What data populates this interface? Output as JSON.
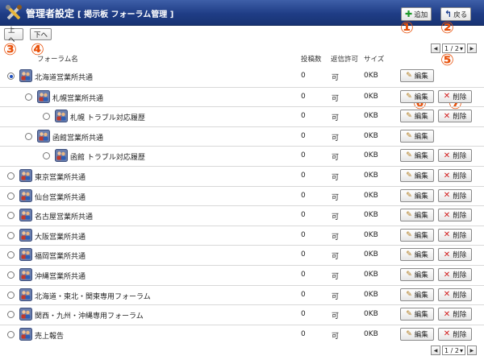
{
  "header": {
    "title": "管理者設定",
    "subtitle": "[ 掲示板 フォーラム管理 ]",
    "add_label": "追加",
    "back_label": "戻る"
  },
  "nav": {
    "up_label": "上へ",
    "down_label": "下へ"
  },
  "pager": {
    "value": "1 / 2"
  },
  "callouts": [
    "①",
    "②",
    "③",
    "④",
    "⑤",
    "⑥",
    "⑦"
  ],
  "columns": {
    "name": "フォーラム名",
    "posts": "投稿数",
    "reply": "返信許可",
    "size": "サイズ"
  },
  "buttons": {
    "edit": "編集",
    "delete": "削除"
  },
  "rows": [
    {
      "name": "北海道営業所共通",
      "posts": "0",
      "reply": "可",
      "size": "0KB",
      "level": 0,
      "selected": true,
      "deletable": false
    },
    {
      "name": "札幌営業所共通",
      "posts": "0",
      "reply": "可",
      "size": "0KB",
      "level": 1,
      "selected": false,
      "deletable": true
    },
    {
      "name": "札幌 トラブル対応履歴",
      "posts": "0",
      "reply": "可",
      "size": "0KB",
      "level": 2,
      "selected": false,
      "deletable": true
    },
    {
      "name": "函館営業所共通",
      "posts": "0",
      "reply": "可",
      "size": "0KB",
      "level": 1,
      "selected": false,
      "deletable": false
    },
    {
      "name": "函館 トラブル対応履歴",
      "posts": "0",
      "reply": "可",
      "size": "0KB",
      "level": 2,
      "selected": false,
      "deletable": true
    },
    {
      "name": "東京営業所共通",
      "posts": "0",
      "reply": "可",
      "size": "0KB",
      "level": 0,
      "selected": false,
      "deletable": true
    },
    {
      "name": "仙台営業所共通",
      "posts": "0",
      "reply": "可",
      "size": "0KB",
      "level": 0,
      "selected": false,
      "deletable": true
    },
    {
      "name": "名古屋営業所共通",
      "posts": "0",
      "reply": "可",
      "size": "0KB",
      "level": 0,
      "selected": false,
      "deletable": true
    },
    {
      "name": "大阪営業所共通",
      "posts": "0",
      "reply": "可",
      "size": "0KB",
      "level": 0,
      "selected": false,
      "deletable": true
    },
    {
      "name": "福岡営業所共通",
      "posts": "0",
      "reply": "可",
      "size": "0KB",
      "level": 0,
      "selected": false,
      "deletable": true
    },
    {
      "name": "沖縄営業所共通",
      "posts": "0",
      "reply": "可",
      "size": "0KB",
      "level": 0,
      "selected": false,
      "deletable": true
    },
    {
      "name": "北海道・東北・関東専用フォーラム",
      "posts": "0",
      "reply": "可",
      "size": "0KB",
      "level": 0,
      "selected": false,
      "deletable": true
    },
    {
      "name": "関西・九州・沖縄専用フォーラム",
      "posts": "0",
      "reply": "可",
      "size": "0KB",
      "level": 0,
      "selected": false,
      "deletable": true
    },
    {
      "name": "売上報告",
      "posts": "0",
      "reply": "可",
      "size": "0KB",
      "level": 0,
      "selected": false,
      "deletable": true
    }
  ],
  "icons": {
    "title": "tools-icon",
    "add": "plus-icon",
    "back": "back-arrow-icon",
    "forum": "forum-group-icon",
    "edit": "pencil-icon",
    "delete": "x-icon"
  },
  "colors": {
    "header_bg": "#1f3d86",
    "callout": "#e8520c",
    "radio_selected": "#1f4fbf",
    "delete_x": "#d21b1b"
  }
}
